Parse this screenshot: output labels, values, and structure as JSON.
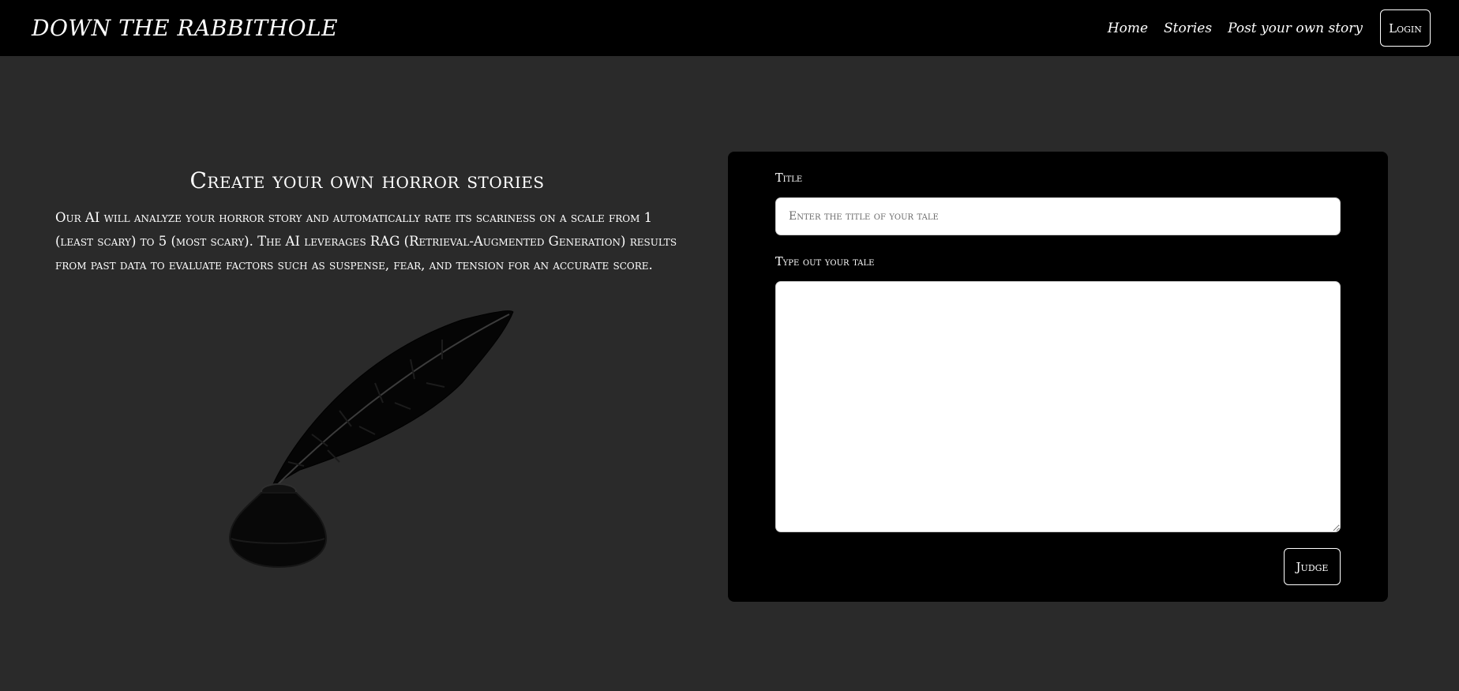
{
  "navbar": {
    "brand": "DOWN THE RABBITHOLE",
    "links": [
      "Home",
      "Stories",
      "Post your own story"
    ],
    "login_label": "Login"
  },
  "intro": {
    "title": "Create your own horror stories",
    "text": "Our AI will analyze your horror story and automatically rate its scariness on a scale from 1 (least scary) to 5 (most scary). The AI leverages RAG (Retrieval-Augmented Generation) results from past data to evaluate factors such as suspense, fear, and tension for an accurate score."
  },
  "illustration": {
    "icon": "quill-inkwell-icon"
  },
  "form": {
    "title_label": "Title",
    "title_placeholder": "Enter the title of your tale",
    "title_value": "",
    "tale_label": "Type out your tale",
    "tale_value": "",
    "judge_label": "Judge"
  },
  "colors": {
    "background": "#2a2a2a",
    "navbar": "#000000",
    "panel": "#000000",
    "text": "#ffffff"
  }
}
